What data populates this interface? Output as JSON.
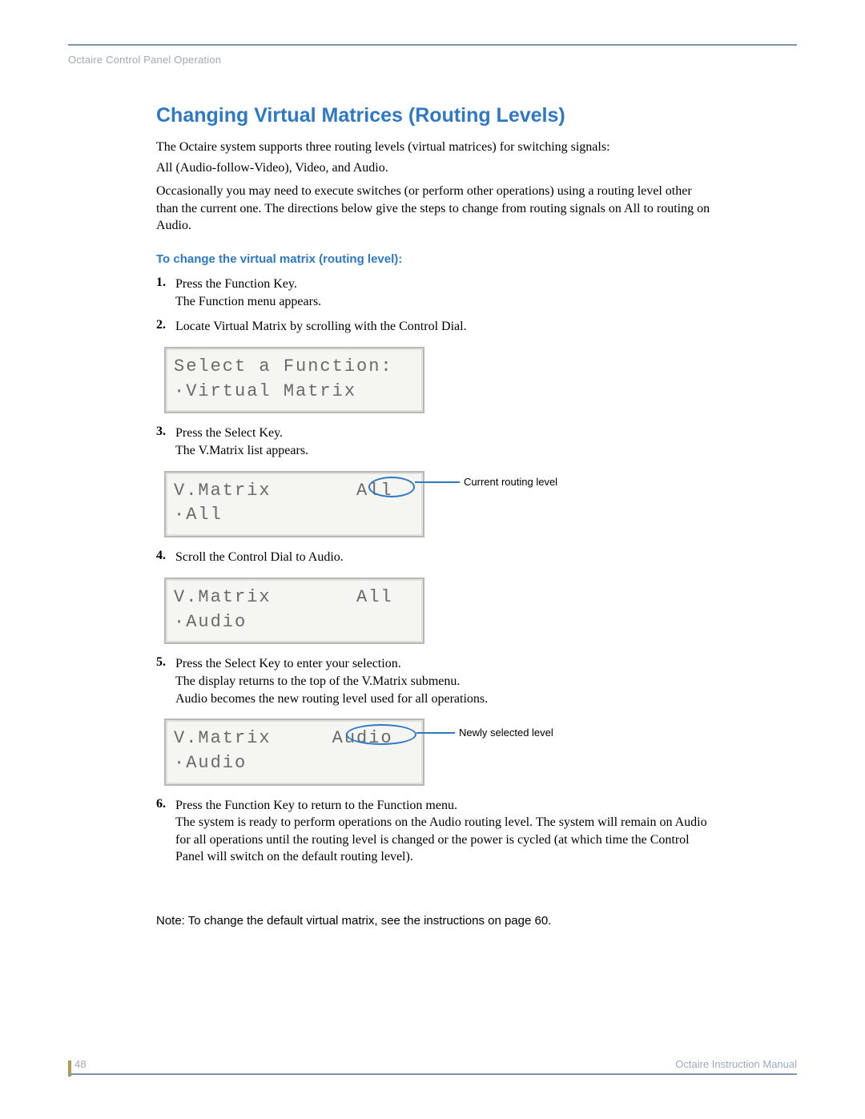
{
  "header": {
    "breadcrumb": "Octaire Control Panel Operation"
  },
  "section": {
    "title": "Changing Virtual Matrices (Routing Levels)",
    "intro1": "The Octaire system supports three routing levels (virtual matrices) for switching signals:",
    "intro2": "All (Audio-follow-Video), Video, and Audio.",
    "intro3": "Occasionally you may need to execute switches (or perform other operations) using a routing level other than the current one. The directions below give the steps to change from routing signals on All to routing on Audio.",
    "subhead": "To change the virtual matrix (routing level):"
  },
  "steps": [
    {
      "n": "1.",
      "t1": "Press the Function Key.",
      "t2": "The Function menu appears."
    },
    {
      "n": "2.",
      "t1": "Locate Virtual Matrix by scrolling with the Control Dial."
    },
    {
      "n": "3.",
      "t1": "Press the Select Key.",
      "t2": "The V.Matrix list appears."
    },
    {
      "n": "4.",
      "t1": "Scroll the Control Dial to Audio."
    },
    {
      "n": "5.",
      "t1": "Press the Select Key to enter your selection.",
      "t2": "The display returns to the top of the V.Matrix submenu.",
      "t3": "Audio becomes the new routing level used for all operations."
    },
    {
      "n": "6.",
      "t1": "Press the Function Key to return to the Function menu.",
      "t2": "The system is ready to perform operations on the Audio routing level. The system will remain on Audio for all operations until the routing level is changed or the power is cycled (at which time the Control Panel will switch on the default routing level)."
    }
  ],
  "lcds": {
    "d1l1": "Select a Function:",
    "d1l2": "·Virtual Matrix",
    "d2l1": "V.Matrix       All",
    "d2l2": "·All",
    "d3l1": "V.Matrix       All",
    "d3l2": "·Audio",
    "d4l1": "V.Matrix     Audio",
    "d4l2": "·Audio"
  },
  "annotations": {
    "a1": "Current routing level",
    "a2": "Newly selected level"
  },
  "note": "Note: To change the default virtual matrix, see the instructions on page 60.",
  "footer": {
    "page": "48",
    "manual": "Octaire Instruction Manual"
  }
}
